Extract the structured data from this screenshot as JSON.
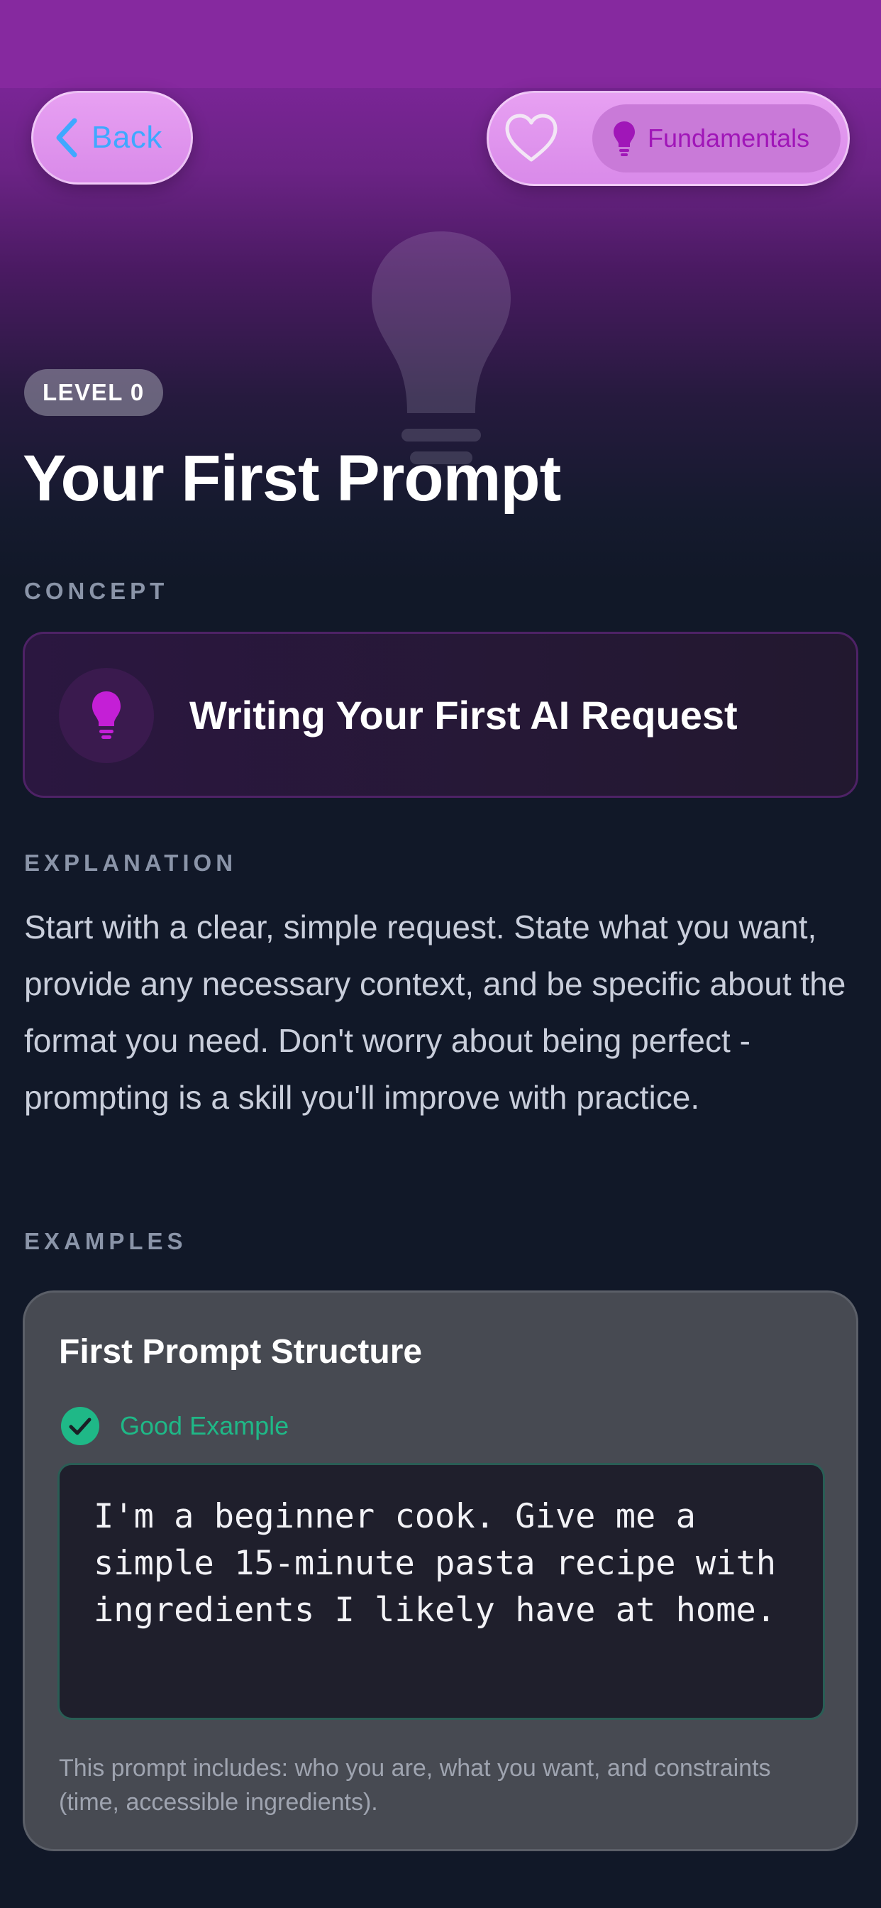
{
  "nav": {
    "back_label": "Back",
    "category_label": "Fundamentals",
    "favorite_icon": "heart-outline-icon",
    "category_icon": "lightbulb-icon"
  },
  "header": {
    "level_badge": "LEVEL 0",
    "title": "Your First Prompt"
  },
  "concept": {
    "section_label": "CONCEPT",
    "title": "Writing Your First AI Request",
    "icon": "lightbulb-icon"
  },
  "explanation": {
    "section_label": "EXPLANATION",
    "text": "Start with a clear, simple request. State what you want, provide any necessary context, and be specific about the format you need. Don't worry about being perfect - prompting is a skill you'll improve with practice."
  },
  "examples": {
    "section_label": "EXAMPLES",
    "items": [
      {
        "title": "First Prompt Structure",
        "status_label": "Good Example",
        "status_icon": "check-circle-icon",
        "prompt": "I'm a beginner cook. Give me a simple 15-minute pasta recipe with ingredients I likely have at home.",
        "note": "This prompt includes: who you are, what you want, and constraints (time, accessible ingredients)."
      }
    ]
  },
  "colors": {
    "accent_purple": "#a016b8",
    "back_blue": "#3fa8ff",
    "good_green": "#1fb887",
    "background": "#111828"
  }
}
